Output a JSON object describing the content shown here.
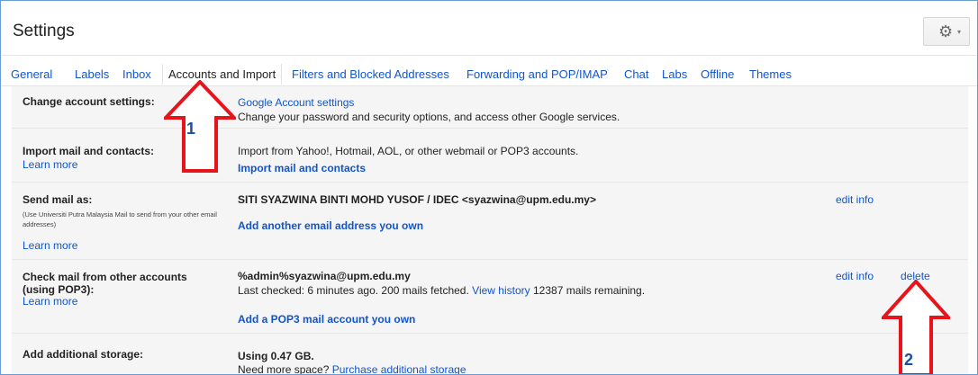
{
  "header": {
    "title": "Settings",
    "gear_icon": "⚙",
    "caret_icon": "▾"
  },
  "tabs": [
    {
      "label": "General"
    },
    {
      "label": "Labels"
    },
    {
      "label": "Inbox"
    },
    {
      "label": "Accounts and Import"
    },
    {
      "label": "Filters and Blocked Addresses"
    },
    {
      "label": "Forwarding and POP/IMAP"
    },
    {
      "label": "Chat"
    },
    {
      "label": "Labs"
    },
    {
      "label": "Offline"
    },
    {
      "label": "Themes"
    }
  ],
  "rows": {
    "change": {
      "label": "Change account settings:",
      "link": "Google Account settings",
      "desc": "Change your password and security options, and access other Google services."
    },
    "import": {
      "label": "Import mail and contacts:",
      "learn": "Learn more",
      "desc": "Import from Yahoo!, Hotmail, AOL, or other webmail or POP3 accounts.",
      "link": "Import mail and contacts"
    },
    "send": {
      "label": "Send mail as:",
      "note": "(Use Universiti Putra Malaysia Mail to send from your other email addresses)",
      "learn": "Learn more",
      "identity": "SITI SYAZWINA BINTI MOHD YUSOF / IDEC <syazwina@upm.edu.my>",
      "edit": "edit info",
      "add": "Add another email address you own"
    },
    "check": {
      "label_line1": "Check mail from other accounts",
      "label_line2": "(using POP3):",
      "learn": "Learn more",
      "account": "%admin%syazwina@upm.edu.my",
      "status_prefix": "Last checked: 6 minutes ago. 200 mails fetched.",
      "history": "View history",
      "remaining": "12387 mails remaining.",
      "edit": "edit info",
      "delete": "delete",
      "add": "Add a POP3 mail account you own"
    },
    "storage": {
      "label": "Add additional storage:",
      "using": "Using 0.47 GB.",
      "need": "Need more space?",
      "purchase": "Purchase additional storage"
    }
  },
  "annotations": {
    "arrow1_number": "1",
    "arrow2_number": "2",
    "arrow_color": "#e8141b"
  }
}
